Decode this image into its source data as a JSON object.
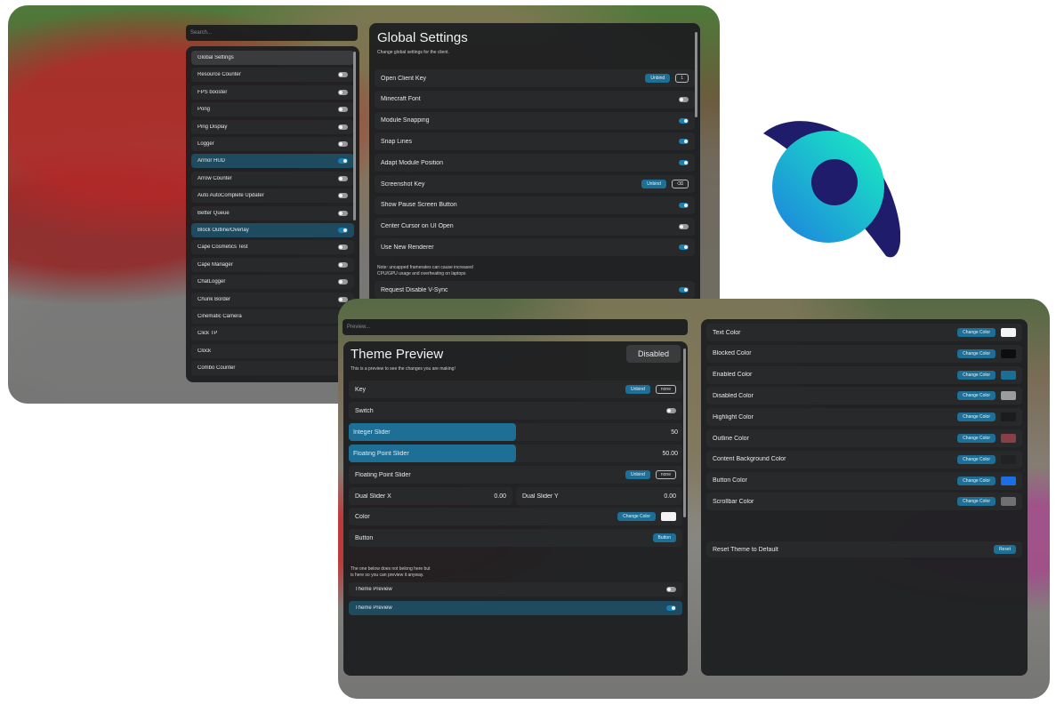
{
  "colors": {
    "accent": "#1e6f95",
    "panel": "#1e1f21",
    "row": "#28292b",
    "active_row": "#1f4b61",
    "logo_navy": "#1f1c6b",
    "logo_cyan": "#19e6c6",
    "logo_blue": "#1a8fe0"
  },
  "sidebar": {
    "search_placeholder": "Search...",
    "items": [
      {
        "label": "Global Settings",
        "icon": "none"
      },
      {
        "label": "Resource Counter",
        "icon": "toggle-icon"
      },
      {
        "label": "FPS booster",
        "icon": "toggle-icon"
      },
      {
        "label": "Pong",
        "icon": "toggle-icon"
      },
      {
        "label": "Ping Display",
        "icon": "toggle-icon"
      },
      {
        "label": "Logger",
        "icon": "toggle-icon"
      },
      {
        "label": "Armor HUD",
        "icon": "toggle-icon"
      },
      {
        "label": "Arrow Counter",
        "icon": "toggle-icon"
      },
      {
        "label": "Auto AutoComplete Updater",
        "icon": "toggle-icon"
      },
      {
        "label": "Better Queue",
        "icon": "toggle-icon"
      },
      {
        "label": "Block Outline/Overlay",
        "icon": "toggle-icon"
      },
      {
        "label": "Cape Cosmetics Test",
        "icon": "toggle-icon"
      },
      {
        "label": "Cape Manager",
        "icon": "toggle-icon"
      },
      {
        "label": "ChatLogger",
        "icon": "toggle-icon"
      },
      {
        "label": "Chunk Border",
        "icon": "toggle-icon"
      },
      {
        "label": "Cinematic Camera",
        "icon": "toggle-icon"
      },
      {
        "label": "Click TP",
        "icon": "toggle-icon"
      },
      {
        "label": "Clock",
        "icon": "toggle-icon"
      },
      {
        "label": "Combo Counter",
        "icon": "toggle-icon"
      }
    ]
  },
  "global_settings": {
    "title": "Global Settings",
    "subtitle": "Change global settings for the client.",
    "rows": [
      {
        "label": "Open Client Key",
        "badge": "Unbind",
        "key": "1"
      },
      {
        "label": "Minecraft Font"
      },
      {
        "label": "Module Snapping"
      },
      {
        "label": "Snap Lines"
      },
      {
        "label": "Adapt Module Position"
      },
      {
        "label": "Screenshot Key",
        "badge": "Unbind",
        "key": "⌫"
      },
      {
        "label": "Show Pause Screen Button"
      },
      {
        "label": "Center Cursor on UI Open"
      },
      {
        "label": "Use New Renderer"
      }
    ],
    "note_line1": "Note: uncapped framerates can cause increased",
    "note_line2": "CPU/GPU usage and overheating on laptops",
    "vsync_label": "Request Disable V-Sync"
  },
  "preview_search": {
    "placeholder": "Preview..."
  },
  "theme_preview": {
    "title": "Theme Preview",
    "state_button": "Disabled",
    "subtitle": "This is a preview to see the changes you are making!",
    "key_label": "Key",
    "key_badge": "Unbind",
    "key_value": "none",
    "switch_label": "Switch",
    "int_slider_label": "Integer Slider",
    "int_slider_value": "50",
    "float_slider_label": "Floating Point Slider",
    "float_slider_value": "50.00",
    "float_key_label": "Floating Point Slider",
    "float_key_badge": "Unbind",
    "float_key_value": "none",
    "dual_x_label": "Dual Slider X",
    "dual_x_value": "0.00",
    "dual_y_label": "Dual Slider Y",
    "dual_y_value": "0.00",
    "color_label": "Color",
    "color_button": "Change Color",
    "button_label": "Button",
    "button_text": "Button",
    "note_line1": "The one below does not belong here but",
    "note_line2": "is here so you can preview it anyway.",
    "item1_label": "Theme Preview",
    "item2_label": "Theme Preview"
  },
  "theme_colors": {
    "change_label": "Change Color",
    "rows": [
      {
        "label": "Text Color",
        "swatch": "#f4f4f4"
      },
      {
        "label": "Blocked Color",
        "swatch": "#0e0e10"
      },
      {
        "label": "Enabled Color",
        "swatch": "#1a6f96"
      },
      {
        "label": "Disabled Color",
        "swatch": "#9c9c9c"
      },
      {
        "label": "Highlight Color",
        "swatch": "#1c1c1e"
      },
      {
        "label": "Outline Color",
        "swatch": "#8a3f46"
      },
      {
        "label": "Content Background Color",
        "swatch": "#222224"
      },
      {
        "label": "Button Color",
        "swatch": "#1a6fe6"
      },
      {
        "label": "Scrollbar Color",
        "swatch": "#707070"
      }
    ],
    "reset_label": "Reset Theme to Default",
    "reset_button": "Reset"
  }
}
